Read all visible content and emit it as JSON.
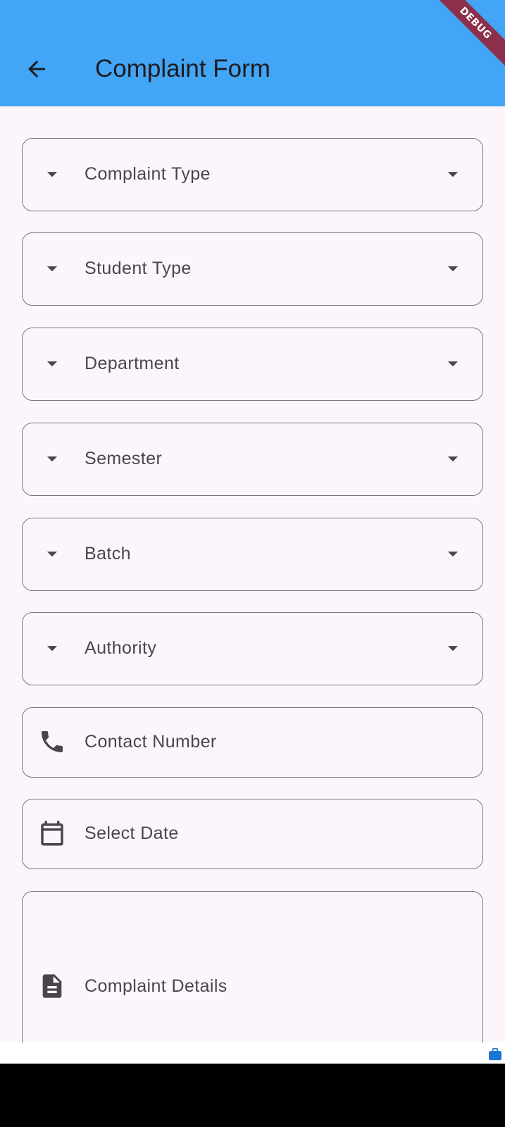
{
  "app_bar": {
    "title": "Complaint Form",
    "background": "#42a5f5",
    "back_icon": "arrow-back-icon",
    "debug_banner": "DEBUG"
  },
  "form": {
    "fields": [
      {
        "label": "Complaint Type",
        "type": "dropdown",
        "leading_icon": "arrow-drop-down-icon",
        "trailing_icon": "arrow-drop-down-icon"
      },
      {
        "label": "Student Type",
        "type": "dropdown",
        "leading_icon": "arrow-drop-down-icon",
        "trailing_icon": "arrow-drop-down-icon"
      },
      {
        "label": "Department",
        "type": "dropdown",
        "leading_icon": "arrow-drop-down-icon",
        "trailing_icon": "arrow-drop-down-icon"
      },
      {
        "label": "Semester",
        "type": "dropdown",
        "leading_icon": "arrow-drop-down-icon",
        "trailing_icon": "arrow-drop-down-icon"
      },
      {
        "label": "Batch",
        "type": "dropdown",
        "leading_icon": "arrow-drop-down-icon",
        "trailing_icon": "arrow-drop-down-icon"
      },
      {
        "label": "Authority",
        "type": "dropdown",
        "leading_icon": "arrow-drop-down-icon",
        "trailing_icon": "arrow-drop-down-icon"
      },
      {
        "label": "Contact Number",
        "type": "text",
        "leading_icon": "phone-icon"
      },
      {
        "label": "Select Date",
        "type": "date",
        "leading_icon": "calendar-icon"
      },
      {
        "label": "Complaint Details",
        "type": "multiline",
        "leading_icon": "document-icon"
      }
    ]
  },
  "colors": {
    "page_background": "#fcf6fc",
    "outline": "#79747e",
    "label_text": "#49454f",
    "title_text": "#1d1b20",
    "debug_banner": "#8b2f4b"
  }
}
